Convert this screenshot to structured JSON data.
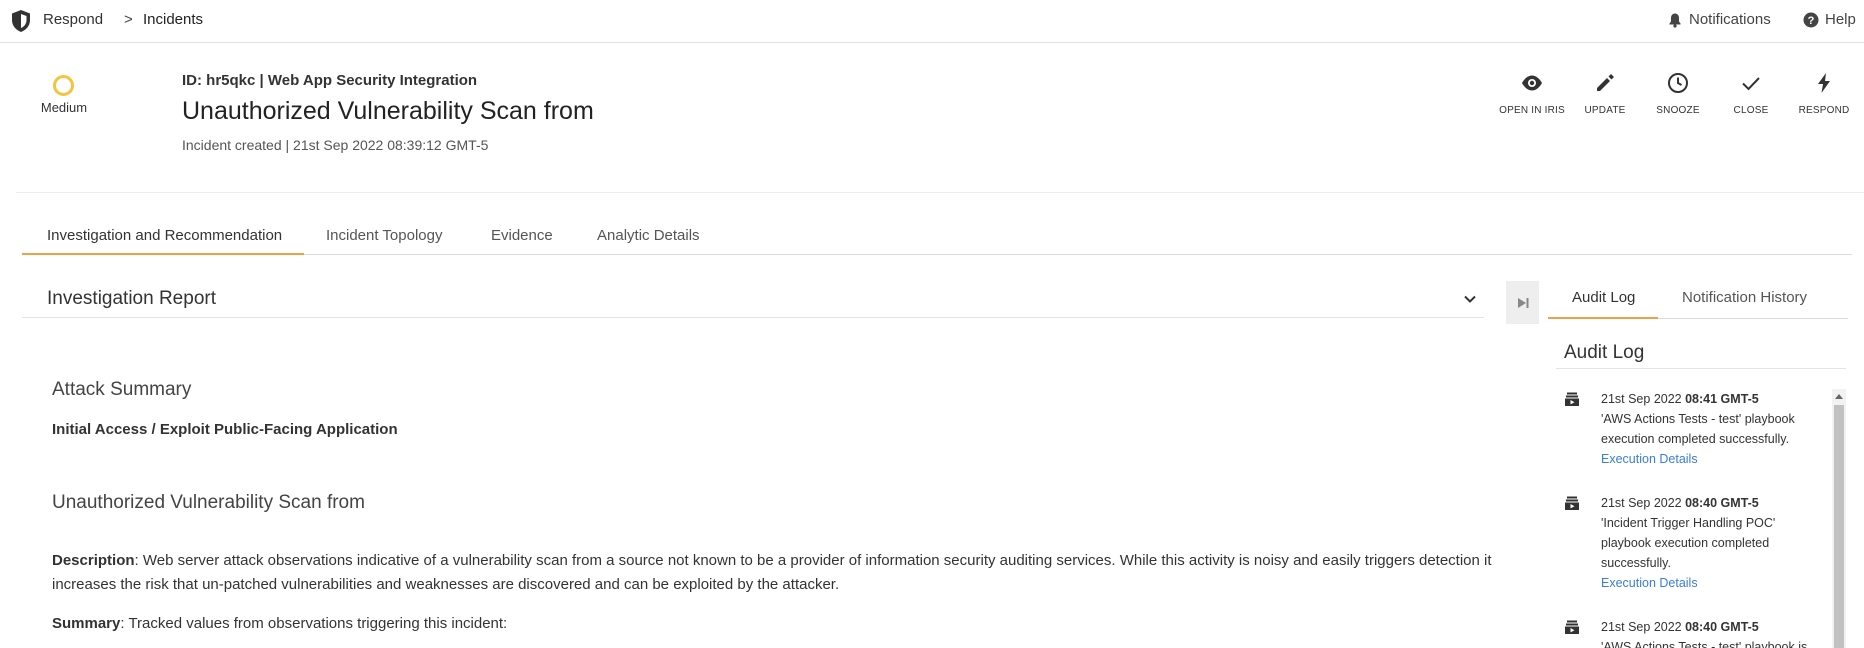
{
  "topbar": {
    "breadcrumb_root": "Respond",
    "breadcrumb_sep": ">",
    "breadcrumb_current": "Incidents",
    "notifications_label": "Notifications",
    "help_label": "Help"
  },
  "incident": {
    "severity": "Medium",
    "severity_color": "#f5c43c",
    "id_line": "ID: hr5qkc | Web App Security Integration",
    "title": "Unauthorized Vulnerability Scan from",
    "created": "Incident created | 21st Sep 2022 08:39:12 GMT-5"
  },
  "actions": [
    {
      "label": "OPEN IN IRIS",
      "icon": "eye-icon"
    },
    {
      "label": "UPDATE",
      "icon": "pencil-icon"
    },
    {
      "label": "SNOOZE",
      "icon": "clock-icon"
    },
    {
      "label": "CLOSE",
      "icon": "check-icon"
    },
    {
      "label": "RESPOND",
      "icon": "bolt-icon"
    }
  ],
  "tabs": [
    {
      "label": "Investigation and Recommendation",
      "active": true
    },
    {
      "label": "Incident Topology",
      "active": false
    },
    {
      "label": "Evidence",
      "active": false
    },
    {
      "label": "Analytic Details",
      "active": false
    }
  ],
  "report": {
    "title": "Investigation Report",
    "attack_summary_heading": "Attack Summary",
    "attack_summary_value": "Initial Access / Exploit Public-Facing Application",
    "section_heading": "Unauthorized Vulnerability Scan from",
    "description_label": "Description",
    "description_text": ": Web server attack observations indicative of a vulnerability scan from a source not known to be a provider of information security auditing services. While this activity is noisy and easily triggers detection it increases the risk that un-patched vulnerabilities and weaknesses are discovered and can be exploited by the attacker.",
    "summary_label": "Summary",
    "summary_text": ": Tracked values from observations triggering this incident:"
  },
  "right_panel": {
    "tabs": [
      {
        "label": "Audit Log",
        "active": true
      },
      {
        "label": "Notification History",
        "active": false
      }
    ],
    "title": "Audit Log",
    "entries": [
      {
        "date": "21st Sep 2022 ",
        "time": "08:41 GMT-5",
        "message": "'AWS Actions Tests - test' playbook execution completed successfully.",
        "link": "Execution Details"
      },
      {
        "date": "21st Sep 2022 ",
        "time": "08:40 GMT-5",
        "message": "'Incident Trigger Handling POC' playbook execution completed successfully.",
        "link": "Execution Details"
      },
      {
        "date": "21st Sep 2022 ",
        "time": "08:40 GMT-5",
        "message": "'AWS Actions Tests - test' playbook is",
        "link": ""
      }
    ]
  },
  "colors": {
    "accent": "#f0a04b",
    "link": "#3b7dd8"
  }
}
